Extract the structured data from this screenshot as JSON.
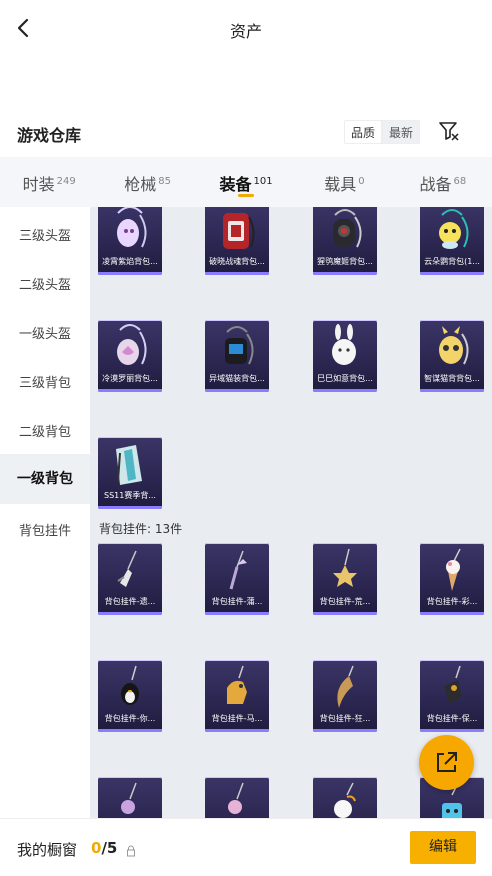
{
  "header": {
    "title": "资产"
  },
  "warehouse": {
    "title": "游戏仓库",
    "sort_options": [
      "品质",
      "最新"
    ],
    "active_sort": "最新"
  },
  "tabs": [
    {
      "label": "时装",
      "count": "249"
    },
    {
      "label": "枪械",
      "count": "85"
    },
    {
      "label": "装备",
      "count": "101",
      "active": true
    },
    {
      "label": "载具",
      "count": "0"
    },
    {
      "label": "战备",
      "count": "68"
    }
  ],
  "sidebar": {
    "items": [
      "三级头盔",
      "二级头盔",
      "一级头盔",
      "三级背包",
      "二级背包",
      "一级背包",
      "背包挂件"
    ],
    "active": "一级背包"
  },
  "items": [
    {
      "caption": "凌霄紫焰背包..."
    },
    {
      "caption": "破晓战魂背包..."
    },
    {
      "caption": "猩鸮魔姬背包..."
    },
    {
      "caption": "云朵鹦背包(1..."
    },
    {
      "caption": "冷漠罗丽背包..."
    },
    {
      "caption": "异域猫装背包..."
    },
    {
      "caption": "巳巳如意背包..."
    },
    {
      "caption": "智谋猫背背包..."
    },
    {
      "caption": "SS11赛季背..."
    }
  ],
  "pendant_section": {
    "label": "背包挂件: 13件"
  },
  "pendants": [
    {
      "caption": "背包挂件-遗..."
    },
    {
      "caption": "背包挂件-蒲..."
    },
    {
      "caption": "背包挂件-荒..."
    },
    {
      "caption": "背包挂件-彩..."
    },
    {
      "caption": "背包挂件-你..."
    },
    {
      "caption": "背包挂件-马..."
    },
    {
      "caption": "背包挂件-狂..."
    },
    {
      "caption": "背包挂件-保..."
    },
    {
      "caption": ""
    },
    {
      "caption": ""
    },
    {
      "caption": ""
    },
    {
      "caption": ""
    }
  ],
  "bottom": {
    "title": "我的橱窗",
    "count_current": "0",
    "count_total": "/5",
    "edit_label": "编辑"
  },
  "colors": {
    "accent": "#f7b000",
    "card_bg": "#2b2650"
  }
}
